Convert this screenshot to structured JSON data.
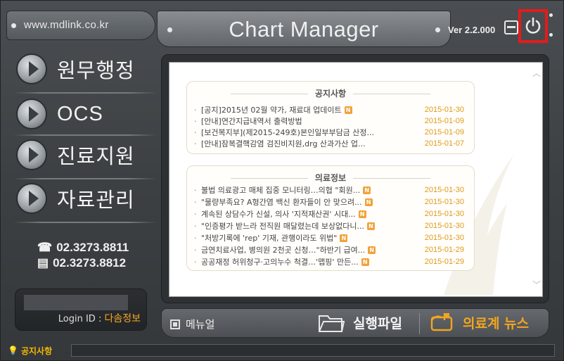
{
  "header": {
    "url": "www.mdlink.co.kr",
    "title": "Chart Manager",
    "version": "Ver 2.2.000"
  },
  "nav": {
    "items": [
      {
        "label": "원무행정"
      },
      {
        "label": "OCS"
      },
      {
        "label": "진료지원"
      },
      {
        "label": "자료관리"
      }
    ]
  },
  "contact": {
    "phone": "02.3273.8811",
    "fax": "02.3273.8812"
  },
  "login": {
    "label": "Login ID :",
    "name": "다솜정보"
  },
  "notices": {
    "title": "공지사항",
    "items": [
      {
        "text": "[공지]2015년 02월 약가, 재료대 업데이트",
        "new": "N",
        "date": "2015-01-30"
      },
      {
        "text": "[안내]연간지급내역서 출력방법",
        "new": "",
        "date": "2015-01-09"
      },
      {
        "text": "[보건복지부](제2015-249호)본인일부부담금 산정...",
        "new": "",
        "date": "2015-01-09"
      },
      {
        "text": "[안내]잠복결핵감염 검진비지원,drg 산과가산 업...",
        "new": "",
        "date": "2015-01-07"
      }
    ]
  },
  "medical_info": {
    "title": "의료정보",
    "items": [
      {
        "text": "불법 의료광고 매체 집중 모니터링…의협 \"회원...",
        "new": "N",
        "date": "2015-01-30"
      },
      {
        "text": "\"물량부족요? A형간염 백신 환자들이 안 맞으려...",
        "new": "N",
        "date": "2015-01-30"
      },
      {
        "text": "계속된 상담수가 신설, 의사 '지적재산권' 시대...",
        "new": "N",
        "date": "2015-01-30"
      },
      {
        "text": "\"인증평가 받느라 전직원 매달렸는데 보상없다니...",
        "new": "N",
        "date": "2015-01-30"
      },
      {
        "text": "\"처방기록에 'rep' 기재, 관행이라도 위법\"",
        "new": "N",
        "date": "2015-01-30"
      },
      {
        "text": "금연치료사업, 병의원 2천곳 신청…\"하반기 급여...",
        "new": "N",
        "date": "2015-01-29"
      },
      {
        "text": "공공재정 허위청구·고의누수 척결…'맵핑' 만든...",
        "new": "N",
        "date": "2015-01-29"
      }
    ]
  },
  "bottom": {
    "manual": "메뉴얼",
    "exec": "실행파일",
    "news": "의료계 뉴스"
  },
  "notice_bar": {
    "label": "공지사항"
  },
  "colors": {
    "accent": "#f2a520",
    "date": "#e09a1a",
    "highlight_border": "#e41b1b"
  }
}
